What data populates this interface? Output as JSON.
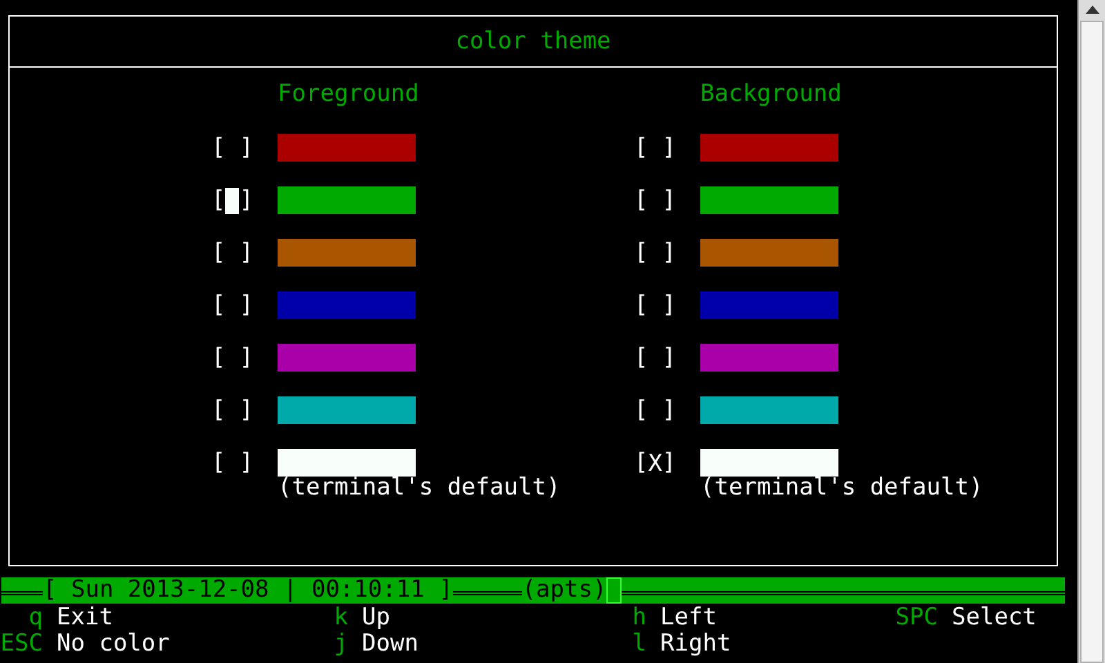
{
  "window": {
    "title": "color theme"
  },
  "checkbox_glyphs": {
    "open": "[",
    "close": "]",
    "mark": "X"
  },
  "columns": [
    {
      "heading": "Foreground",
      "options": [
        {
          "color": "#aa0000",
          "checked": false,
          "focused": false
        },
        {
          "color": "#00aa00",
          "checked": false,
          "focused": true
        },
        {
          "color": "#aa5500",
          "checked": false,
          "focused": false
        },
        {
          "color": "#0000aa",
          "checked": false,
          "focused": false
        },
        {
          "color": "#aa00aa",
          "checked": false,
          "focused": false
        },
        {
          "color": "#00aaaa",
          "checked": false,
          "focused": false
        },
        {
          "color": "#f8fffa",
          "checked": false,
          "focused": false,
          "label": "(terminal's default)"
        }
      ]
    },
    {
      "heading": "Background",
      "options": [
        {
          "color": "#aa0000",
          "checked": false,
          "focused": false
        },
        {
          "color": "#00aa00",
          "checked": false,
          "focused": false
        },
        {
          "color": "#aa5500",
          "checked": false,
          "focused": false
        },
        {
          "color": "#0000aa",
          "checked": false,
          "focused": false
        },
        {
          "color": "#aa00aa",
          "checked": false,
          "focused": false
        },
        {
          "color": "#00aaaa",
          "checked": false,
          "focused": false
        },
        {
          "color": "#f8fffa",
          "checked": true,
          "focused": false,
          "label": "(terminal's default)"
        }
      ]
    }
  ],
  "status_bar": {
    "datetime": "[ Sun 2013-12-08 | 00:10:11 ]",
    "mode": "(apts)"
  },
  "help": [
    [
      {
        "key": "q",
        "action": "Exit"
      },
      {
        "key": "k",
        "action": "Up"
      },
      {
        "key": "h",
        "action": "Left"
      },
      {
        "key": "SPC",
        "action": "Select"
      }
    ],
    [
      {
        "key": "ESC",
        "action": "No color"
      },
      {
        "key": "j",
        "action": "Down"
      },
      {
        "key": "l",
        "action": "Right"
      }
    ]
  ]
}
